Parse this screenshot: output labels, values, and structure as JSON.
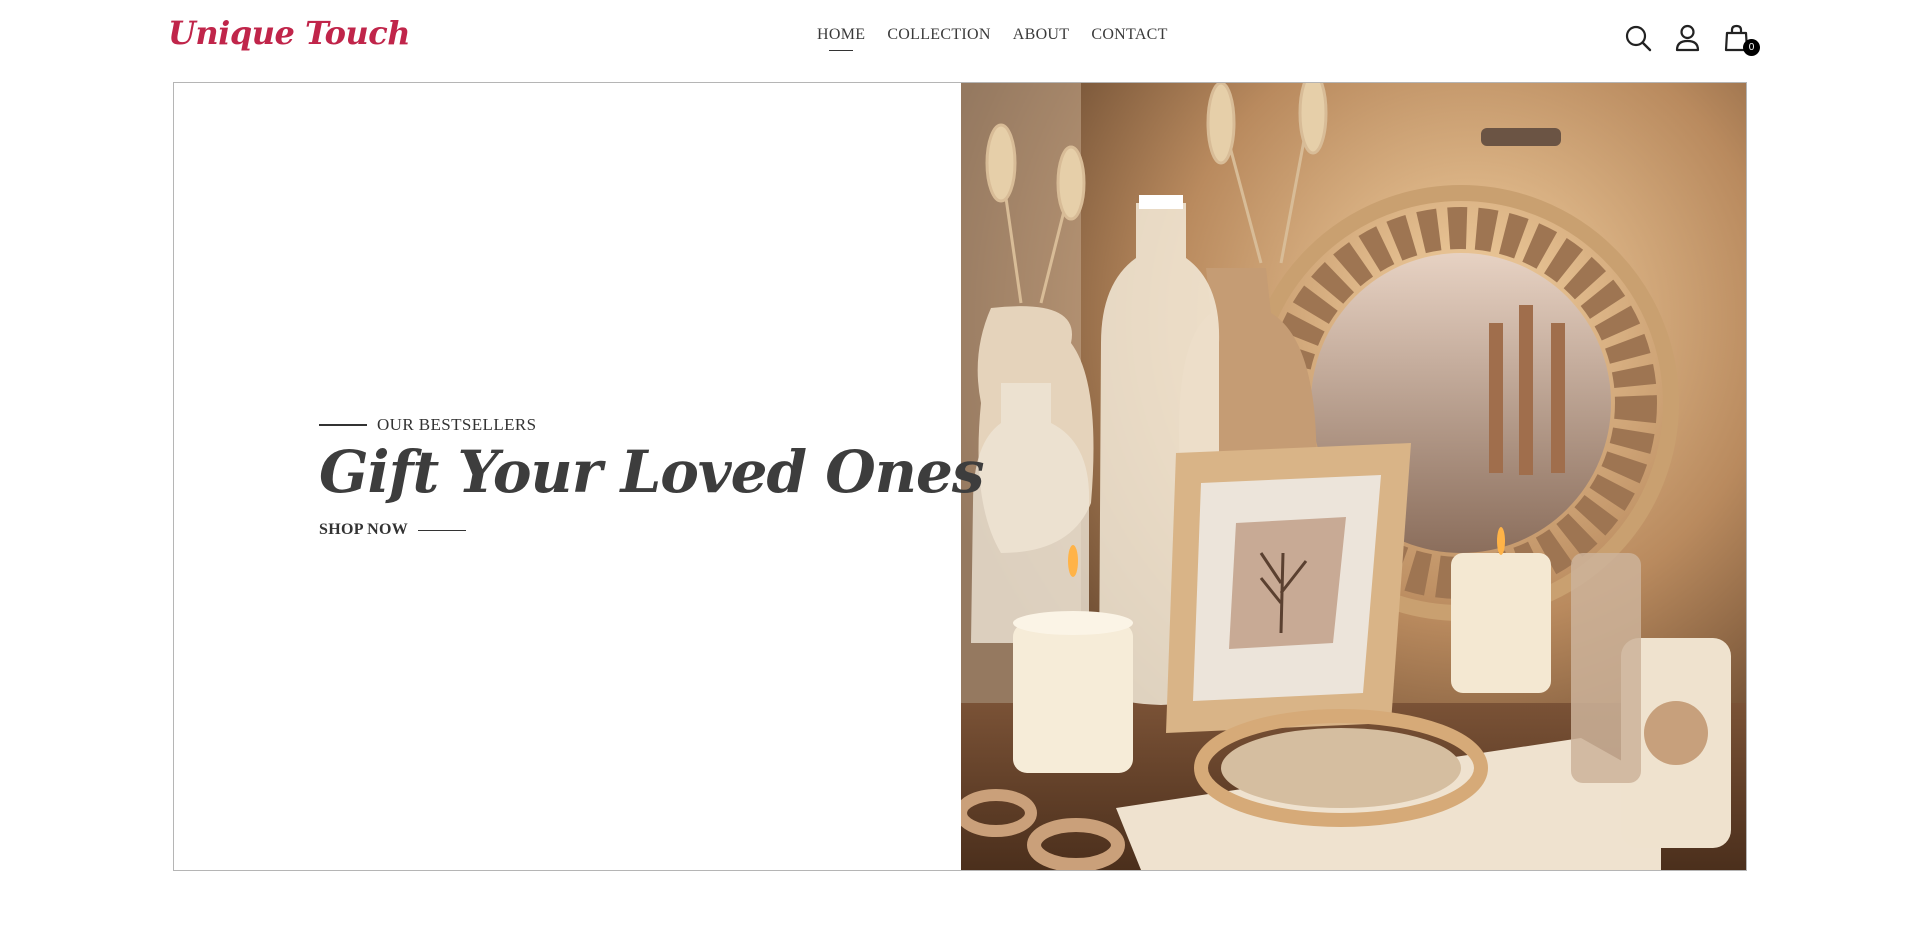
{
  "brand": {
    "name": "Unique Touch",
    "color": "#c0254a"
  },
  "nav": {
    "items": [
      "HOME",
      "COLLECTION",
      "ABOUT",
      "CONTACT"
    ],
    "active": "HOME"
  },
  "header_icons": [
    "search-icon",
    "user-icon",
    "shopping-bag-icon"
  ],
  "cart": {
    "count": "0"
  },
  "hero": {
    "kicker": "OUR BESTSELLERS",
    "headline": "Gift Your Loved Ones",
    "cta": "SHOP NOW",
    "image_subject": "candles, glass bottles, wooden frames and embroidery hoops in warm beige tones"
  }
}
